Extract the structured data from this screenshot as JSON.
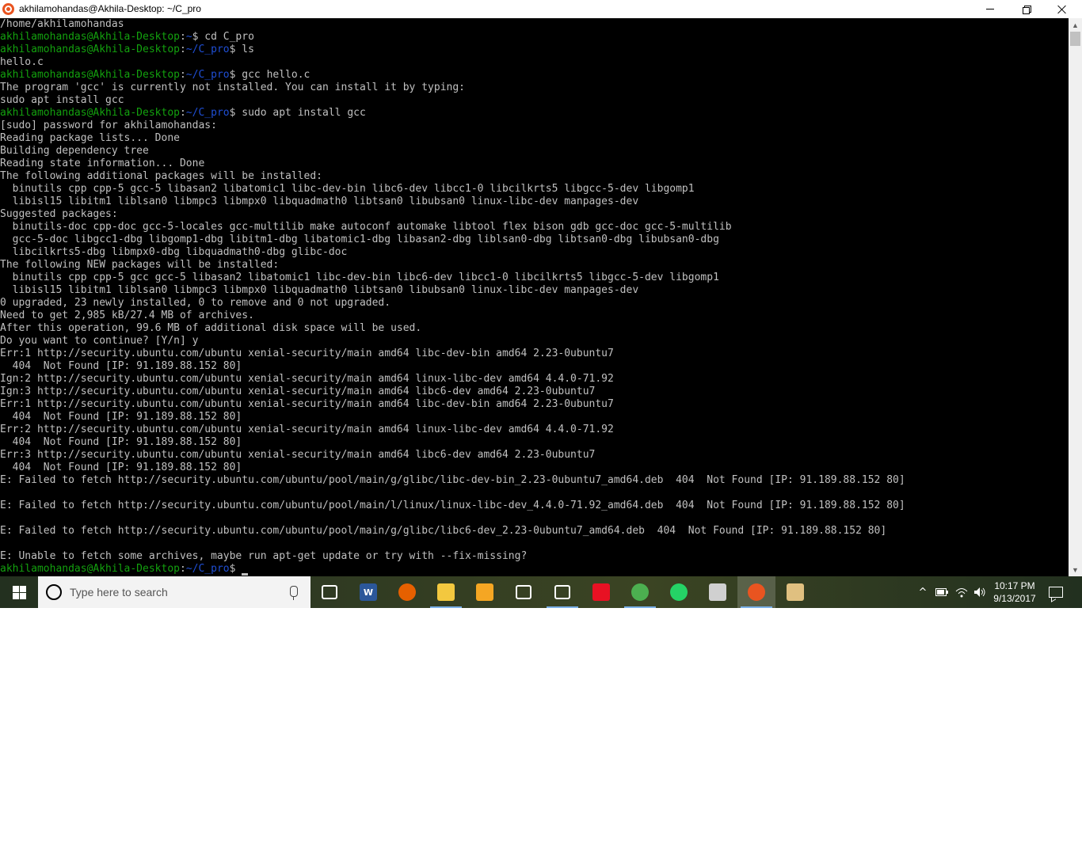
{
  "window": {
    "title": "akhilamohandas@Akhila-Desktop: ~/C_pro",
    "minimize_symbol": "",
    "close_symbol": ""
  },
  "terminal": {
    "lines": [
      {
        "text": "/home/akhilamohandas"
      },
      {
        "user": "akhilamohandas@Akhila-Desktop",
        "path": "~",
        "cmd": "$ cd C_pro"
      },
      {
        "user": "akhilamohandas@Akhila-Desktop",
        "path": "~/C_pro",
        "cmd": "$ ls"
      },
      {
        "text": "hello.c"
      },
      {
        "user": "akhilamohandas@Akhila-Desktop",
        "path": "~/C_pro",
        "cmd": "$ gcc hello.c"
      },
      {
        "text": "The program 'gcc' is currently not installed. You can install it by typing:"
      },
      {
        "text": "sudo apt install gcc"
      },
      {
        "user": "akhilamohandas@Akhila-Desktop",
        "path": "~/C_pro",
        "cmd": "$ sudo apt install gcc"
      },
      {
        "text": "[sudo] password for akhilamohandas:"
      },
      {
        "text": "Reading package lists... Done"
      },
      {
        "text": "Building dependency tree"
      },
      {
        "text": "Reading state information... Done"
      },
      {
        "text": "The following additional packages will be installed:"
      },
      {
        "text": "  binutils cpp cpp-5 gcc-5 libasan2 libatomic1 libc-dev-bin libc6-dev libcc1-0 libcilkrts5 libgcc-5-dev libgomp1"
      },
      {
        "text": "  libisl15 libitm1 liblsan0 libmpc3 libmpx0 libquadmath0 libtsan0 libubsan0 linux-libc-dev manpages-dev"
      },
      {
        "text": "Suggested packages:"
      },
      {
        "text": "  binutils-doc cpp-doc gcc-5-locales gcc-multilib make autoconf automake libtool flex bison gdb gcc-doc gcc-5-multilib"
      },
      {
        "text": "  gcc-5-doc libgcc1-dbg libgomp1-dbg libitm1-dbg libatomic1-dbg libasan2-dbg liblsan0-dbg libtsan0-dbg libubsan0-dbg"
      },
      {
        "text": "  libcilkrts5-dbg libmpx0-dbg libquadmath0-dbg glibc-doc"
      },
      {
        "text": "The following NEW packages will be installed:"
      },
      {
        "text": "  binutils cpp cpp-5 gcc gcc-5 libasan2 libatomic1 libc-dev-bin libc6-dev libcc1-0 libcilkrts5 libgcc-5-dev libgomp1"
      },
      {
        "text": "  libisl15 libitm1 liblsan0 libmpc3 libmpx0 libquadmath0 libtsan0 libubsan0 linux-libc-dev manpages-dev"
      },
      {
        "text": "0 upgraded, 23 newly installed, 0 to remove and 0 not upgraded."
      },
      {
        "text": "Need to get 2,985 kB/27.4 MB of archives."
      },
      {
        "text": "After this operation, 99.6 MB of additional disk space will be used."
      },
      {
        "text": "Do you want to continue? [Y/n] y"
      },
      {
        "text": "Err:1 http://security.ubuntu.com/ubuntu xenial-security/main amd64 libc-dev-bin amd64 2.23-0ubuntu7"
      },
      {
        "text": "  404  Not Found [IP: 91.189.88.152 80]"
      },
      {
        "text": "Ign:2 http://security.ubuntu.com/ubuntu xenial-security/main amd64 linux-libc-dev amd64 4.4.0-71.92"
      },
      {
        "text": "Ign:3 http://security.ubuntu.com/ubuntu xenial-security/main amd64 libc6-dev amd64 2.23-0ubuntu7"
      },
      {
        "text": "Err:1 http://security.ubuntu.com/ubuntu xenial-security/main amd64 libc-dev-bin amd64 2.23-0ubuntu7"
      },
      {
        "text": "  404  Not Found [IP: 91.189.88.152 80]"
      },
      {
        "text": "Err:2 http://security.ubuntu.com/ubuntu xenial-security/main amd64 linux-libc-dev amd64 4.4.0-71.92"
      },
      {
        "text": "  404  Not Found [IP: 91.189.88.152 80]"
      },
      {
        "text": "Err:3 http://security.ubuntu.com/ubuntu xenial-security/main amd64 libc6-dev amd64 2.23-0ubuntu7"
      },
      {
        "text": "  404  Not Found [IP: 91.189.88.152 80]"
      },
      {
        "text": "E: Failed to fetch http://security.ubuntu.com/ubuntu/pool/main/g/glibc/libc-dev-bin_2.23-0ubuntu7_amd64.deb  404  Not Found [IP: 91.189.88.152 80]"
      },
      {
        "text": ""
      },
      {
        "text": "E: Failed to fetch http://security.ubuntu.com/ubuntu/pool/main/l/linux/linux-libc-dev_4.4.0-71.92_amd64.deb  404  Not Found [IP: 91.189.88.152 80]"
      },
      {
        "text": ""
      },
      {
        "text": "E: Failed to fetch http://security.ubuntu.com/ubuntu/pool/main/g/glibc/libc6-dev_2.23-0ubuntu7_amd64.deb  404  Not Found [IP: 91.189.88.152 80]"
      },
      {
        "text": ""
      },
      {
        "text": "E: Unable to fetch some archives, maybe run apt-get update or try with --fix-missing?"
      },
      {
        "user": "akhilamohandas@Akhila-Desktop",
        "path": "~/C_pro",
        "cmd": "$ ",
        "cursor": true
      }
    ]
  },
  "taskbar": {
    "search_placeholder": "Type here to search",
    "apps": [
      {
        "name": "task-view",
        "icon": "task-view-icon",
        "color": "#ffffff"
      },
      {
        "name": "word",
        "icon": "word-icon",
        "color": "#2b579a",
        "glyph": "W"
      },
      {
        "name": "firefox",
        "icon": "firefox-icon",
        "color": "#e66000"
      },
      {
        "name": "file-explorer",
        "icon": "folder-icon",
        "color": "#f3c83f"
      },
      {
        "name": "media-player",
        "icon": "media-player-icon",
        "color": "#f5a623"
      },
      {
        "name": "voice-recorder",
        "icon": "microphone-icon",
        "color": "#ffffff"
      },
      {
        "name": "settings",
        "icon": "gear-icon",
        "color": "#ffffff"
      },
      {
        "name": "download-app",
        "icon": "download-icon",
        "color": "#e81123"
      },
      {
        "name": "chrome",
        "icon": "chrome-icon",
        "color": "#4caf50"
      },
      {
        "name": "whatsapp",
        "icon": "whatsapp-icon",
        "color": "#25d366"
      },
      {
        "name": "paint-tool",
        "icon": "paint-icon",
        "color": "#d0d0d0"
      },
      {
        "name": "ubuntu",
        "icon": "ubuntu-icon",
        "color": "#e95420",
        "active": true
      },
      {
        "name": "paint",
        "icon": "palette-icon",
        "color": "#e0c080"
      }
    ],
    "tray": {
      "chevron": "^",
      "time": "10:17 PM",
      "date": "9/13/2017"
    }
  },
  "colors": {
    "prompt_user": "#13a10e",
    "prompt_path": "#1f4fd6",
    "terminal_text": "#c0c0c0",
    "terminal_bg": "#000000"
  }
}
